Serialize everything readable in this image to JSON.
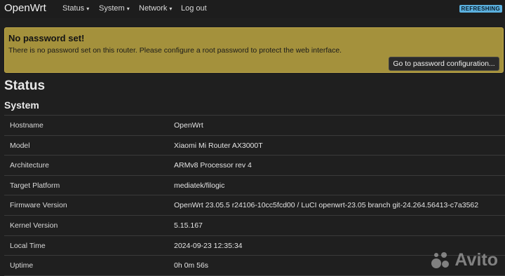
{
  "header": {
    "brand": "OpenWrt",
    "menu": [
      {
        "label": "Status",
        "has_caret": true
      },
      {
        "label": "System",
        "has_caret": true
      },
      {
        "label": "Network",
        "has_caret": true
      },
      {
        "label": "Log out",
        "has_caret": false
      }
    ],
    "caret": "▾",
    "badge": "REFRESHING"
  },
  "alert": {
    "title": "No password set!",
    "message": "There is no password set on this router. Please configure a root password to protect the web interface.",
    "button": "Go to password configuration..."
  },
  "page": {
    "title": "Status",
    "section": "System"
  },
  "system_table": [
    {
      "key": "Hostname",
      "value": "OpenWrt"
    },
    {
      "key": "Model",
      "value": "Xiaomi Mi Router AX3000T"
    },
    {
      "key": "Architecture",
      "value": "ARMv8 Processor rev 4"
    },
    {
      "key": "Target Platform",
      "value": "mediatek/filogic"
    },
    {
      "key": "Firmware Version",
      "value": "OpenWrt 23.05.5 r24106-10cc5fcd00 / LuCI openwrt-23.05 branch git-24.264.56413-c7a3562"
    },
    {
      "key": "Kernel Version",
      "value": "5.15.167"
    },
    {
      "key": "Local Time",
      "value": "2024-09-23 12:35:34"
    },
    {
      "key": "Uptime",
      "value": "0h 0m 56s"
    }
  ],
  "watermark": {
    "text": "Avito",
    "icon": "avito-logo-icon"
  },
  "colors": {
    "background": "#1f1f1f",
    "alert": "#a4913c",
    "badge": "#5bb0de"
  }
}
